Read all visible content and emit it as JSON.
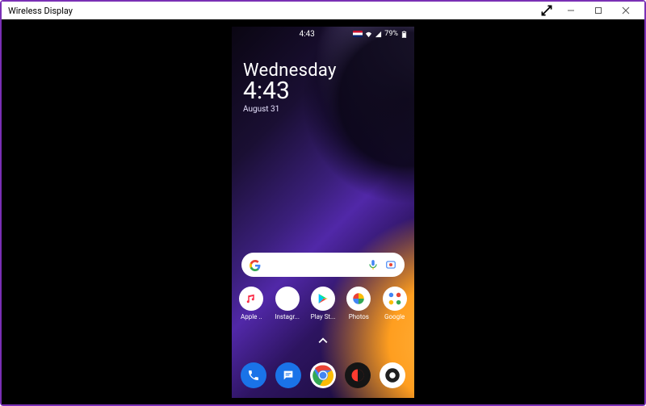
{
  "window": {
    "title": "Wireless Display"
  },
  "phone": {
    "status": {
      "time": "4:43",
      "battery_pct": "79%"
    },
    "clock": {
      "day": "Wednesday",
      "time": "4:43",
      "date": "August 31"
    },
    "search": {
      "placeholder": ""
    },
    "apps": [
      {
        "label": "Apple ..",
        "name": "apple-music"
      },
      {
        "label": "Instagr...",
        "name": "instagram"
      },
      {
        "label": "Play St...",
        "name": "play-store"
      },
      {
        "label": "Photos",
        "name": "photos"
      },
      {
        "label": "Google",
        "name": "google-folder"
      }
    ],
    "dock": [
      {
        "name": "phone"
      },
      {
        "name": "messages"
      },
      {
        "name": "chrome"
      },
      {
        "name": "screen-recorder"
      },
      {
        "name": "camera"
      }
    ]
  }
}
